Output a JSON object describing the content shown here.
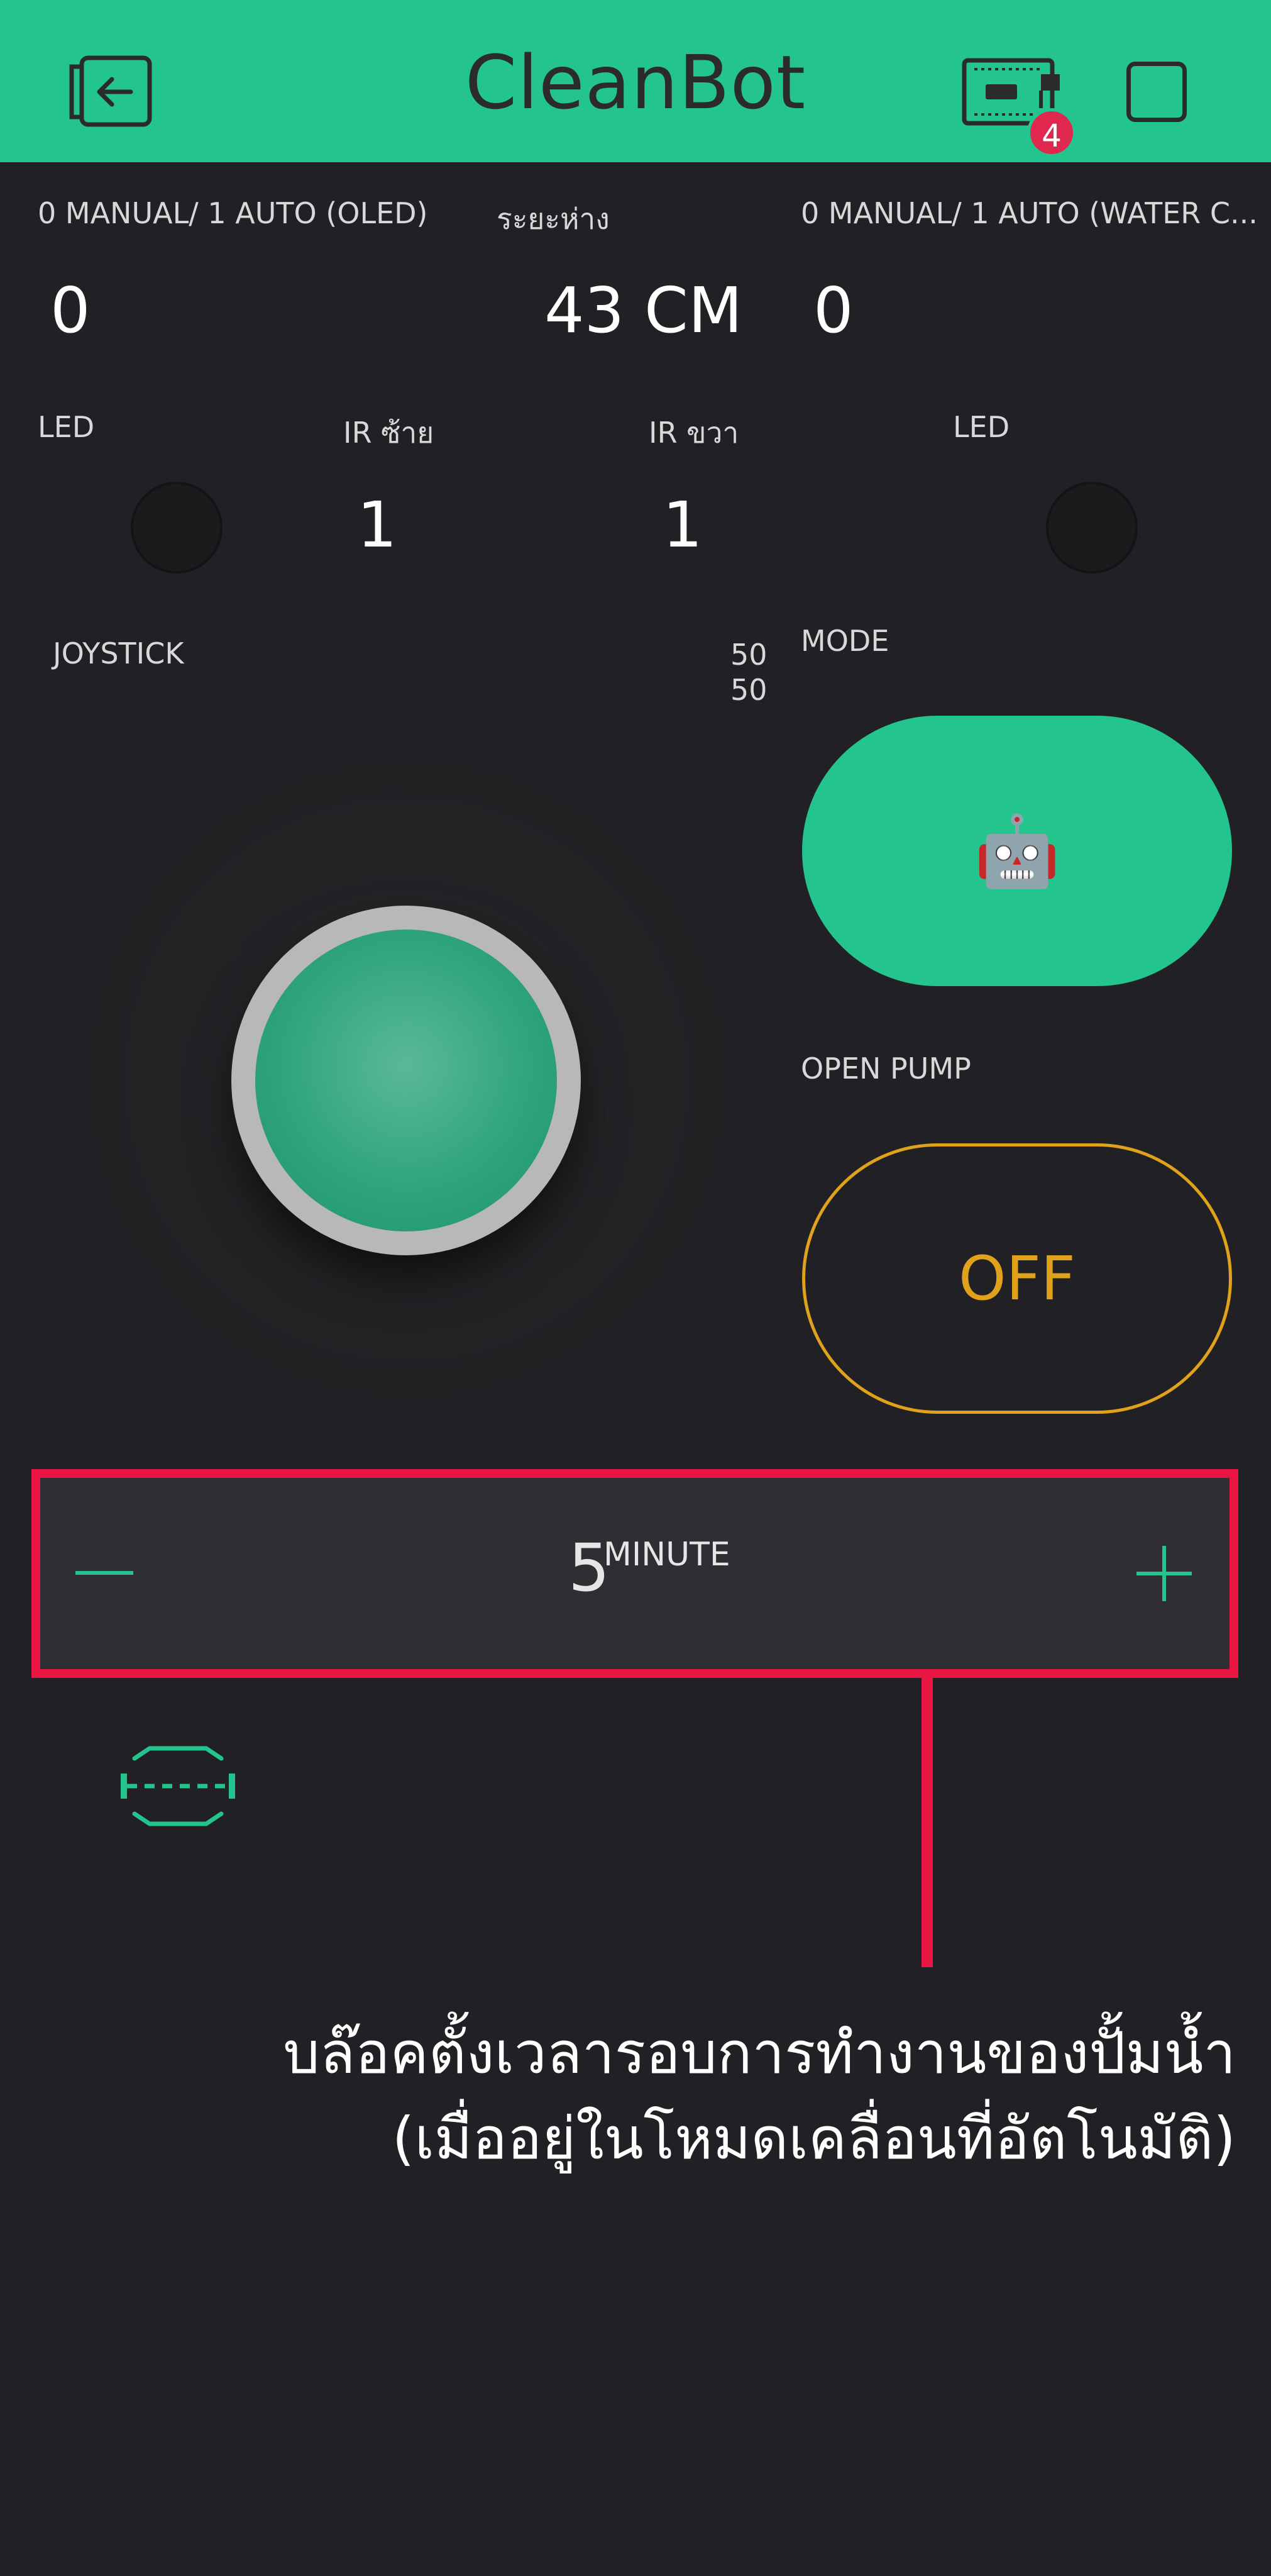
{
  "header": {
    "title": "CleanBot",
    "device_badge": "4",
    "icons": [
      "exit-icon",
      "device-board-icon",
      "stop-square-icon"
    ]
  },
  "displays": {
    "oled_mode": {
      "label": "0 MANUAL/ 1 AUTO (OLED)",
      "value": "0"
    },
    "distance": {
      "label": "ระยะห่าง",
      "value": "43 CM"
    },
    "water_mode": {
      "label": "0 MANUAL/ 1 AUTO (WATER C...",
      "value": "0"
    },
    "led_left": {
      "label": "LED"
    },
    "ir_left": {
      "label": "IR ซ้าย",
      "value": "1"
    },
    "ir_right": {
      "label": "IR ขวา",
      "value": "1"
    },
    "led_right": {
      "label": "LED"
    }
  },
  "joystick": {
    "label": "JOYSTICK",
    "x": "50",
    "y": "50"
  },
  "mode": {
    "label": "MODE",
    "icon": "🤖"
  },
  "pump": {
    "label": "OPEN PUMP",
    "state": "OFF"
  },
  "step": {
    "value": "5",
    "unit": "MINUTE"
  },
  "annotation": {
    "line1": "บล๊อคตั้งเวลารอบการทำงานของปั้มน้ำ",
    "line2": "(เมื่ออยู่ในโหมดเคลื่อนที่อัตโนมัติ)"
  },
  "colors": {
    "accent": "#23c48e",
    "background": "#212125",
    "highlight": "#e81442",
    "pump": "#e0a11b",
    "badge": "#e0284f"
  }
}
